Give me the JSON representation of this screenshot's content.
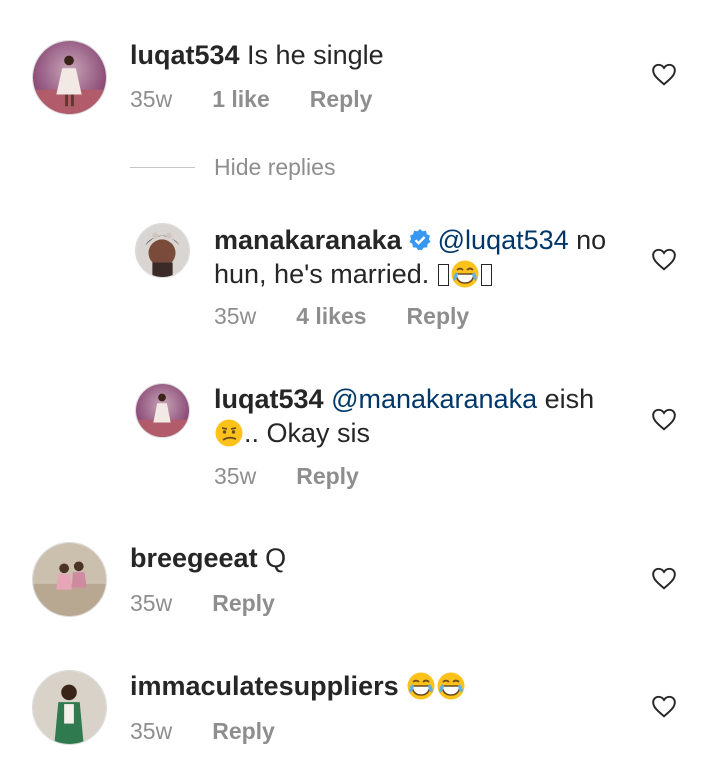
{
  "comments": [
    {
      "username": "luqat534",
      "text": " Is he single",
      "time": "35w",
      "likes": "1 like",
      "reply": "Reply"
    },
    {
      "username": "manakaranaka",
      "mention": "@luqat534",
      "text_line1_rest": " no",
      "text_line2": "hun, he's married. ",
      "time": "35w",
      "likes": "4 likes",
      "reply": "Reply"
    },
    {
      "username": "luqat534",
      "mention": "@manakaranaka",
      "text_line1_rest": " eish",
      "text_line2": ".. Okay sis",
      "time": "35w",
      "reply": "Reply"
    },
    {
      "username": "breegeeat",
      "text": " Q",
      "time": "35w",
      "reply": "Reply"
    },
    {
      "username": "immaculatesuppliers",
      "time": "35w",
      "reply": "Reply"
    }
  ],
  "hide_replies": "Hide replies",
  "colors": {
    "text": "#262626",
    "meta": "#8e8e8e",
    "mention": "#00376b",
    "verified": "#3897f0"
  }
}
